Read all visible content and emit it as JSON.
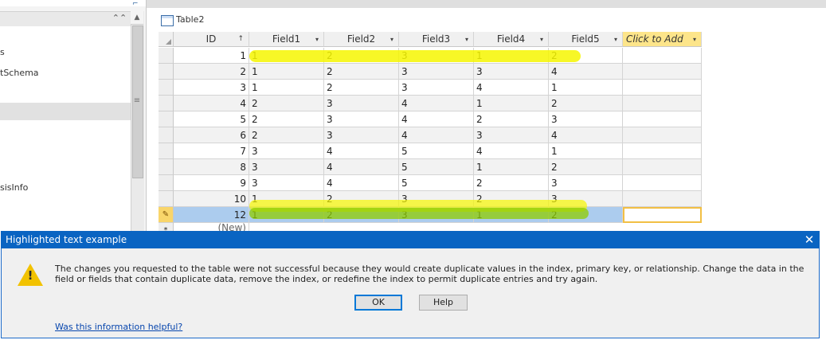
{
  "nav": {
    "items": [
      {
        "label": "s"
      },
      {
        "label": "tSchema"
      },
      {
        "label": ""
      },
      {
        "label": ""
      },
      {
        "label": ""
      },
      {
        "label": ""
      },
      {
        "label": ""
      },
      {
        "label": ""
      },
      {
        "label": "sisInfo"
      }
    ],
    "selected_index": 3
  },
  "tab": {
    "label": "Table2"
  },
  "grid": {
    "columns": [
      {
        "label": "ID",
        "icon": "sort-ascending-icon"
      },
      {
        "label": "Field1"
      },
      {
        "label": "Field2"
      },
      {
        "label": "Field3"
      },
      {
        "label": "Field4"
      },
      {
        "label": "Field5"
      },
      {
        "label": "Click to Add"
      }
    ],
    "rows": [
      [
        "1",
        "1",
        "2",
        "3",
        "1",
        "2"
      ],
      [
        "2",
        "1",
        "2",
        "3",
        "3",
        "4"
      ],
      [
        "3",
        "1",
        "2",
        "3",
        "4",
        "1"
      ],
      [
        "4",
        "2",
        "3",
        "4",
        "1",
        "2"
      ],
      [
        "5",
        "2",
        "3",
        "4",
        "2",
        "3"
      ],
      [
        "6",
        "2",
        "3",
        "4",
        "3",
        "4"
      ],
      [
        "7",
        "3",
        "4",
        "5",
        "4",
        "1"
      ],
      [
        "8",
        "3",
        "4",
        "5",
        "1",
        "2"
      ],
      [
        "9",
        "3",
        "4",
        "5",
        "2",
        "3"
      ],
      [
        "10",
        "1",
        "2",
        "3",
        "2",
        "3"
      ],
      [
        "12",
        "1",
        "2",
        "3",
        "1",
        "2"
      ]
    ],
    "new_row_label": "(New)",
    "highlight_colors": {
      "yellow": "#f6f600",
      "green": "#8fcc00"
    }
  },
  "dialog": {
    "title": "Highlighted text example",
    "message": "The changes you requested to the table were not successful because they would create duplicate values in the index, primary key, or relationship. Change the data in the field or fields that contain duplicate data, remove the index, or redefine the index to permit duplicate entries and try again.",
    "ok_label": "OK",
    "help_label": "Help",
    "helpful_link": "Was this information helpful?",
    "close_glyph": "✕",
    "warning_glyph": "!"
  }
}
